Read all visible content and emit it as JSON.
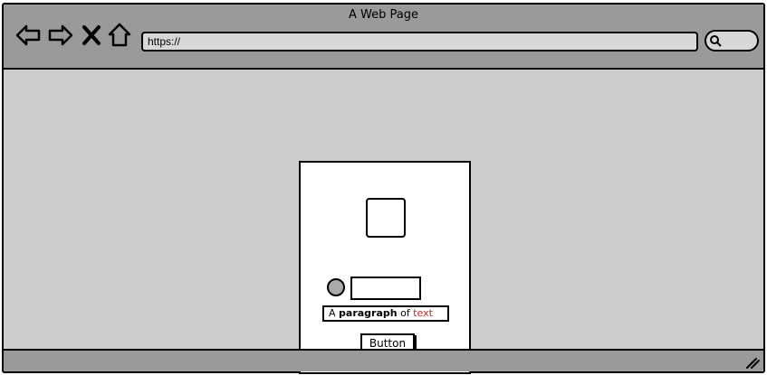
{
  "window": {
    "title": "A Web Page",
    "address_bar": {
      "value": "https://"
    }
  },
  "icons": {
    "back": "back-arrow-icon",
    "forward": "forward-arrow-icon",
    "stop": "close-icon",
    "home": "home-icon",
    "search": "search-icon",
    "resize": "resize-grip-icon"
  },
  "card": {
    "paragraph": {
      "prefix": "A ",
      "bold": "paragraph",
      "middle": " of ",
      "red": "text"
    },
    "button_label": "Button"
  },
  "colors": {
    "chrome": "#9a9a9a",
    "page_bg": "#cccccc",
    "card_bg": "#ffffff",
    "red_text": "#c62828"
  }
}
